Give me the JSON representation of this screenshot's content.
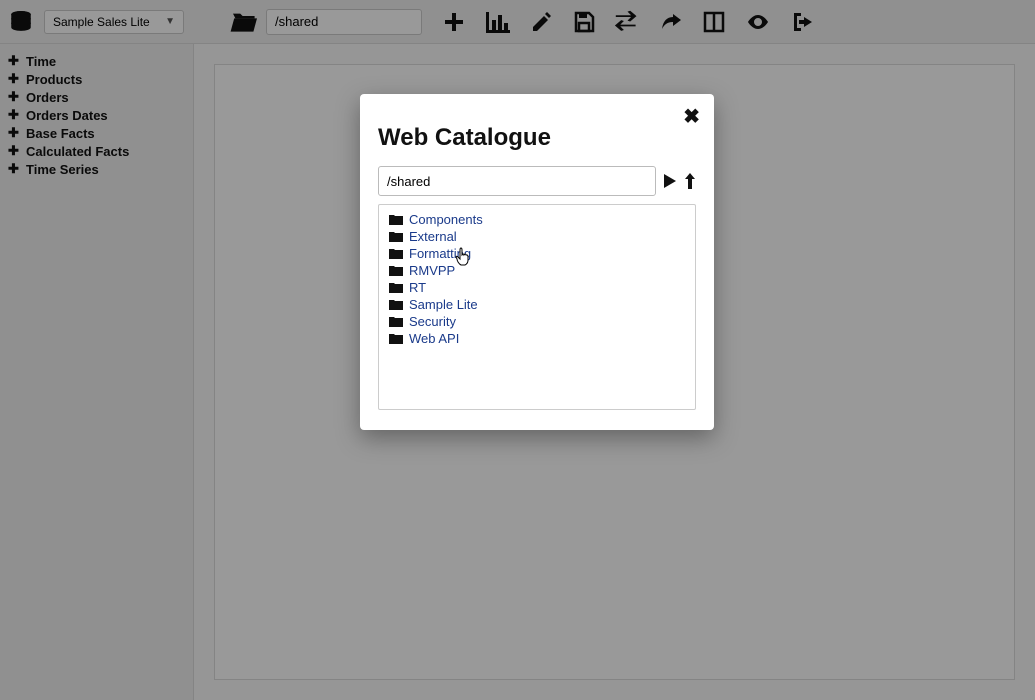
{
  "toolbar": {
    "dataset_selected": "Sample Sales Lite",
    "path_value": "/shared"
  },
  "sidebar": {
    "items": [
      {
        "label": "Time"
      },
      {
        "label": "Products"
      },
      {
        "label": "Orders"
      },
      {
        "label": "Orders Dates"
      },
      {
        "label": "Base Facts"
      },
      {
        "label": "Calculated Facts"
      },
      {
        "label": "Time Series"
      }
    ]
  },
  "modal": {
    "title": "Web Catalogue",
    "path_value": "/shared",
    "folders": [
      {
        "label": "Components"
      },
      {
        "label": "External"
      },
      {
        "label": "Formatting"
      },
      {
        "label": "RMVPP"
      },
      {
        "label": "RT"
      },
      {
        "label": "Sample Lite"
      },
      {
        "label": "Security"
      },
      {
        "label": "Web API"
      }
    ]
  }
}
